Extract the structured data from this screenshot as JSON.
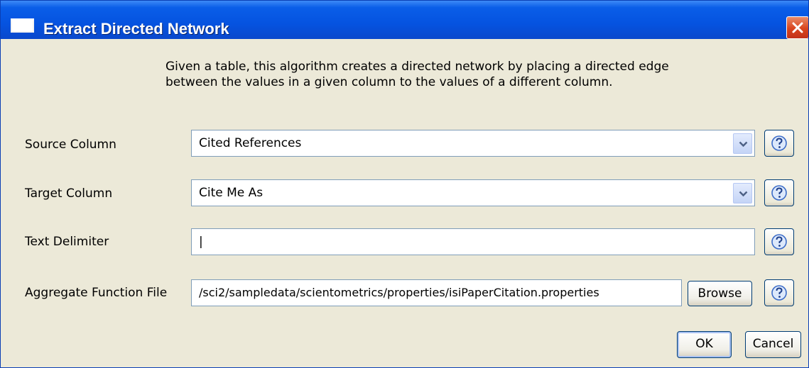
{
  "window": {
    "title": "Extract Directed Network",
    "icon": "window-icon",
    "close_icon": "close-icon"
  },
  "description": "Given a table, this algorithm creates a directed network by placing a directed edge between the values in a given column to the values of a different column.",
  "fields": {
    "source_column": {
      "label": "Source Column",
      "value": "Cited References",
      "icon": "chevron-down-icon",
      "help_icon": "help-icon"
    },
    "target_column": {
      "label": "Target Column",
      "value": "Cite Me As",
      "icon": "chevron-down-icon",
      "help_icon": "help-icon"
    },
    "text_delimiter": {
      "label": "Text Delimiter",
      "value": "|",
      "help_icon": "help-icon"
    },
    "aggregate_function_file": {
      "label": "Aggregate Function File",
      "value": "/sci2/sampledata/scientometrics/properties/isiPaperCitation.properties",
      "browse_label": "Browse",
      "help_icon": "help-icon"
    }
  },
  "buttons": {
    "ok": "OK",
    "cancel": "Cancel"
  },
  "colors": {
    "titlebar": "#0553e0",
    "dialog_bg": "#ece9d8",
    "close_button": "#d9441e"
  }
}
